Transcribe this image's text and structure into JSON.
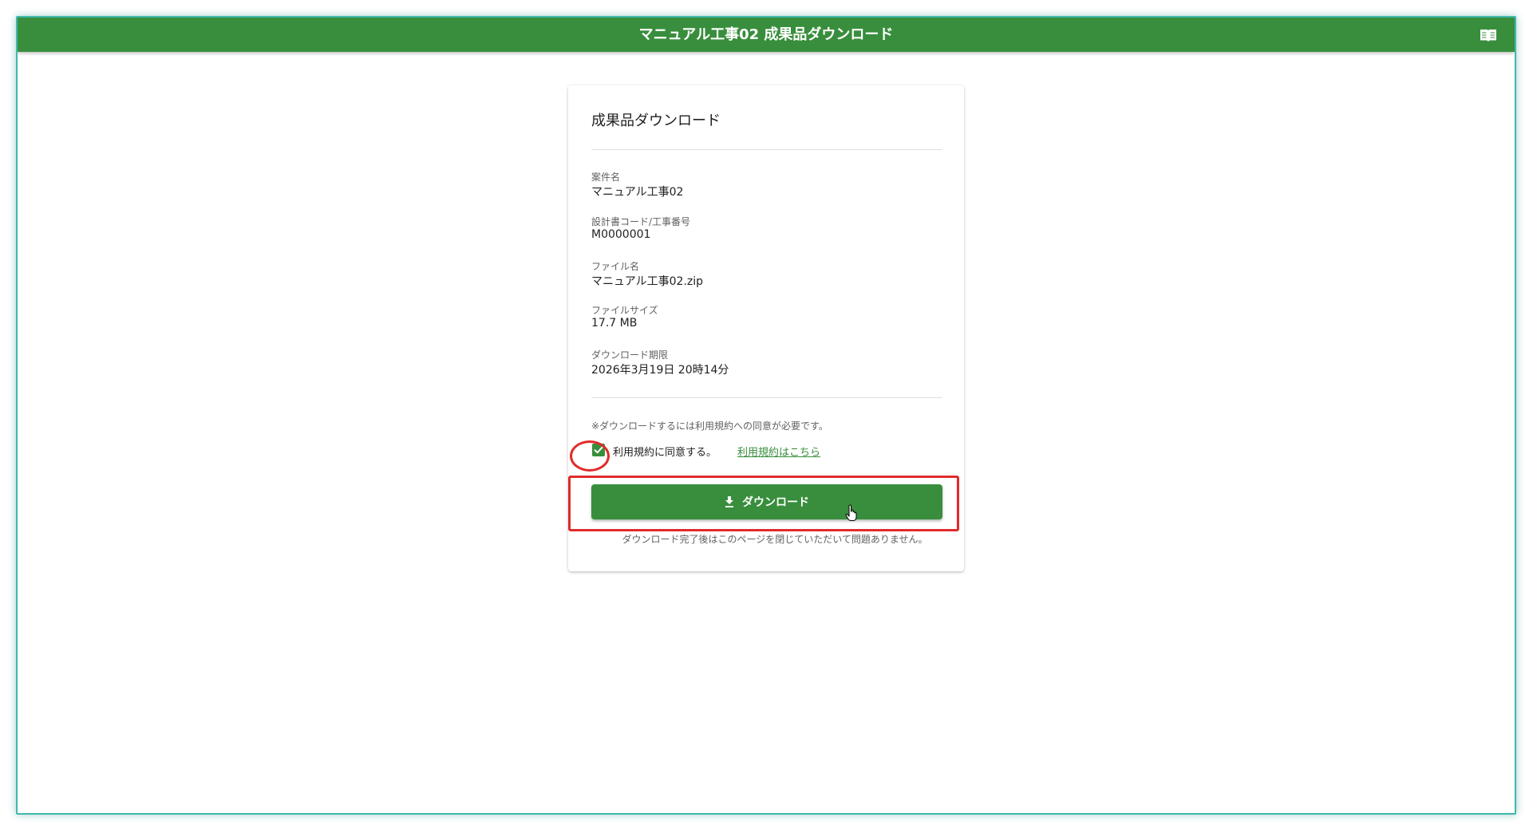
{
  "appbar": {
    "title": "マニュアル工事02 成果品ダウンロード",
    "manual_icon": "book-icon"
  },
  "card": {
    "title": "成果品ダウンロード",
    "fields": [
      {
        "label": "案件名",
        "value": "マニュアル工事02"
      },
      {
        "label": "設計書コード/工事番号",
        "value": "M0000001"
      },
      {
        "label": "ファイル名",
        "value": "マニュアル工事02.zip"
      },
      {
        "label": "ファイルサイズ",
        "value": "17.7 MB"
      },
      {
        "label": "ダウンロード期限",
        "value": "2026年3月19日 20時14分"
      }
    ],
    "notice": "※ダウンロードするには利用規約への同意が必要です。",
    "agree_label": "利用規約に同意する。",
    "agree_checked": true,
    "terms_link": "利用規約はこちら",
    "download_button": "ダウンロード",
    "after_note": "ダウンロード完了後はこのページを閉じていただいて問題ありません。"
  },
  "colors": {
    "primary": "#388e3c",
    "annotation": "#e02b2b"
  }
}
